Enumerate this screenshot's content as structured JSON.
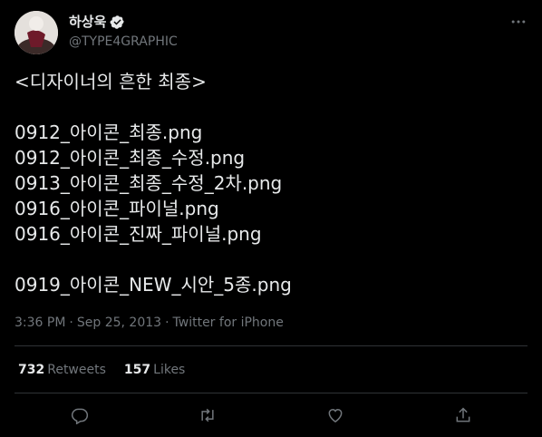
{
  "author": {
    "display_name": "하상욱",
    "handle": "@TYPE4GRAPHIC",
    "verified": true
  },
  "tweet": {
    "lines": [
      "<디자이너의 흔한 최종>",
      "",
      "0912_아이콘_최종.png",
      "0912_아이콘_최종_수정.png",
      "0913_아이콘_최종_수정_2차.png",
      "0916_아이콘_파이널.png",
      "0916_아이콘_진짜_파이널.png",
      "",
      "0919_아이콘_NEW_시안_5종.png"
    ]
  },
  "meta": {
    "time": "3:36 PM",
    "separator1": "·",
    "date": "Sep 25, 2013",
    "separator2": "·",
    "source": "Twitter for iPhone"
  },
  "stats": {
    "retweets_count": "732",
    "retweets_label": "Retweets",
    "likes_count": "157",
    "likes_label": "Likes"
  },
  "actions": {
    "icons": [
      "reply-icon",
      "retweet-icon",
      "like-icon",
      "share-icon"
    ]
  },
  "colors": {
    "background": "#000000",
    "text": "#e7e9ea",
    "secondary": "#71767b",
    "divider": "#2f3336",
    "verified": "#e7e9ea"
  }
}
